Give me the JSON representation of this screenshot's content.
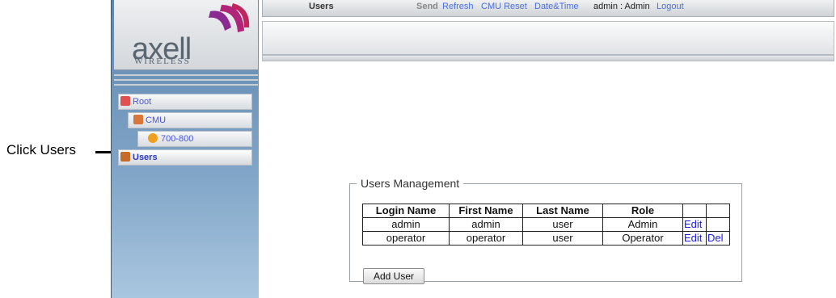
{
  "annotation": {
    "text": "Click Users"
  },
  "logo": {
    "brand": "axell",
    "sub": "WIRELESS"
  },
  "menu": {
    "active": "Users",
    "send": "Send",
    "refresh": "Refresh",
    "cmu_reset": "CMU Reset",
    "datetime": "Date&Time",
    "user": "admin : Admin",
    "logout": "Logout"
  },
  "tree": [
    {
      "label": "Root",
      "icon": "root-icon",
      "color": "#e05050"
    },
    {
      "label": "CMU",
      "icon": "cmu-icon",
      "color": "#d9773a"
    },
    {
      "label": "700-800",
      "icon": "alert-icon",
      "color": "#f0a020"
    },
    {
      "label": "Users",
      "icon": "users-icon",
      "color": "#c86a2a",
      "selected": true
    }
  ],
  "users_management": {
    "legend": "Users Management",
    "headers": [
      "Login Name",
      "First Name",
      "Last Name",
      "Role",
      "",
      ""
    ],
    "rows": [
      {
        "login": "admin",
        "first": "admin",
        "last": "user",
        "role": "Admin",
        "edit": "Edit",
        "del": ""
      },
      {
        "login": "operator",
        "first": "operator",
        "last": "user",
        "role": "Operator",
        "edit": "Edit",
        "del": "Del"
      }
    ],
    "add_button": "Add User"
  }
}
